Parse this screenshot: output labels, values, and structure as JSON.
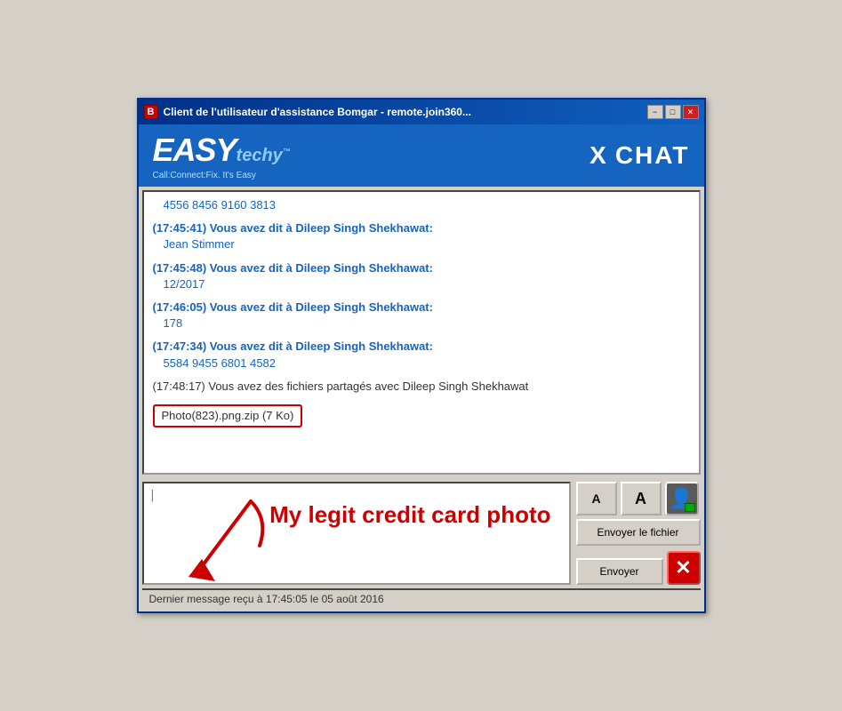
{
  "window": {
    "title": "Client de l'utilisateur d'assistance Bomgar - remote.join360...",
    "icon_label": "B",
    "min_label": "−",
    "max_label": "□",
    "close_label": "✕"
  },
  "header": {
    "logo_easy": "EASY",
    "logo_techy": "techy",
    "logo_tm": "™",
    "tagline": "Call:Connect:Fix. It's Easy",
    "chat_prefix": "X",
    "chat_label": "CHAT"
  },
  "chat": {
    "messages": [
      {
        "type": "number",
        "content": "4556 8456 9160 3813"
      },
      {
        "type": "message",
        "timestamp": "(17:45:41)",
        "sender": "Vous avez dit à Dileep Singh Shekhawat:",
        "content": "Jean Stimmer"
      },
      {
        "type": "message",
        "timestamp": "(17:45:48)",
        "sender": "Vous avez dit à Dileep Singh Shekhawat:",
        "content": "12/2017"
      },
      {
        "type": "message",
        "timestamp": "(17:46:05)",
        "sender": "Vous avez dit à Dileep Singh Shekhawat:",
        "content": "178"
      },
      {
        "type": "message",
        "timestamp": "(17:47:34)",
        "sender": "Vous avez dit à Dileep Singh Shekhawat:",
        "content": "5584 9455 6801 4582"
      },
      {
        "type": "system",
        "content": "(17:48:17) Vous avez des fichiers partagés avec Dileep Singh Shekhawat"
      },
      {
        "type": "file",
        "filename": "Photo(823).png.zip (7 Ko)"
      }
    ]
  },
  "input": {
    "placeholder": "|",
    "annotation_text": "My legit credit card photo",
    "font_small_label": "A",
    "font_large_label": "A",
    "send_file_label": "Envoyer le fichier",
    "send_label": "Envoyer"
  },
  "status_bar": {
    "text": "Dernier message reçu à 17:45:05 le 05 août 2016"
  }
}
